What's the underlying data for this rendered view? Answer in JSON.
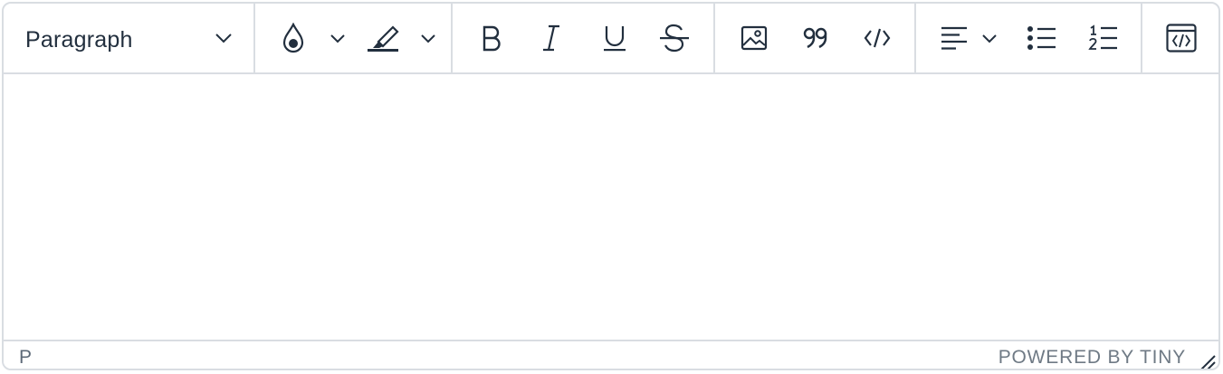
{
  "toolbar": {
    "blocks": {
      "label": "Paragraph"
    },
    "icons": {
      "text_color": "text-color-icon",
      "highlight": "highlight-icon",
      "bold": "bold-icon",
      "italic": "italic-icon",
      "underline": "underline-icon",
      "strikethrough": "strikethrough-icon",
      "image": "image-icon",
      "blockquote": "quote-icon",
      "code": "code-icon",
      "align": "align-left-icon",
      "bullet_list": "bullet-list-icon",
      "numbered_list": "numbered-list-icon",
      "source_code": "source-code-icon"
    }
  },
  "statusbar": {
    "path": "P",
    "branding": "POWERED BY TINY"
  },
  "colors": {
    "border": "#d9dde2",
    "icon": "#222f3e",
    "muted_text": "#6f7a85"
  }
}
